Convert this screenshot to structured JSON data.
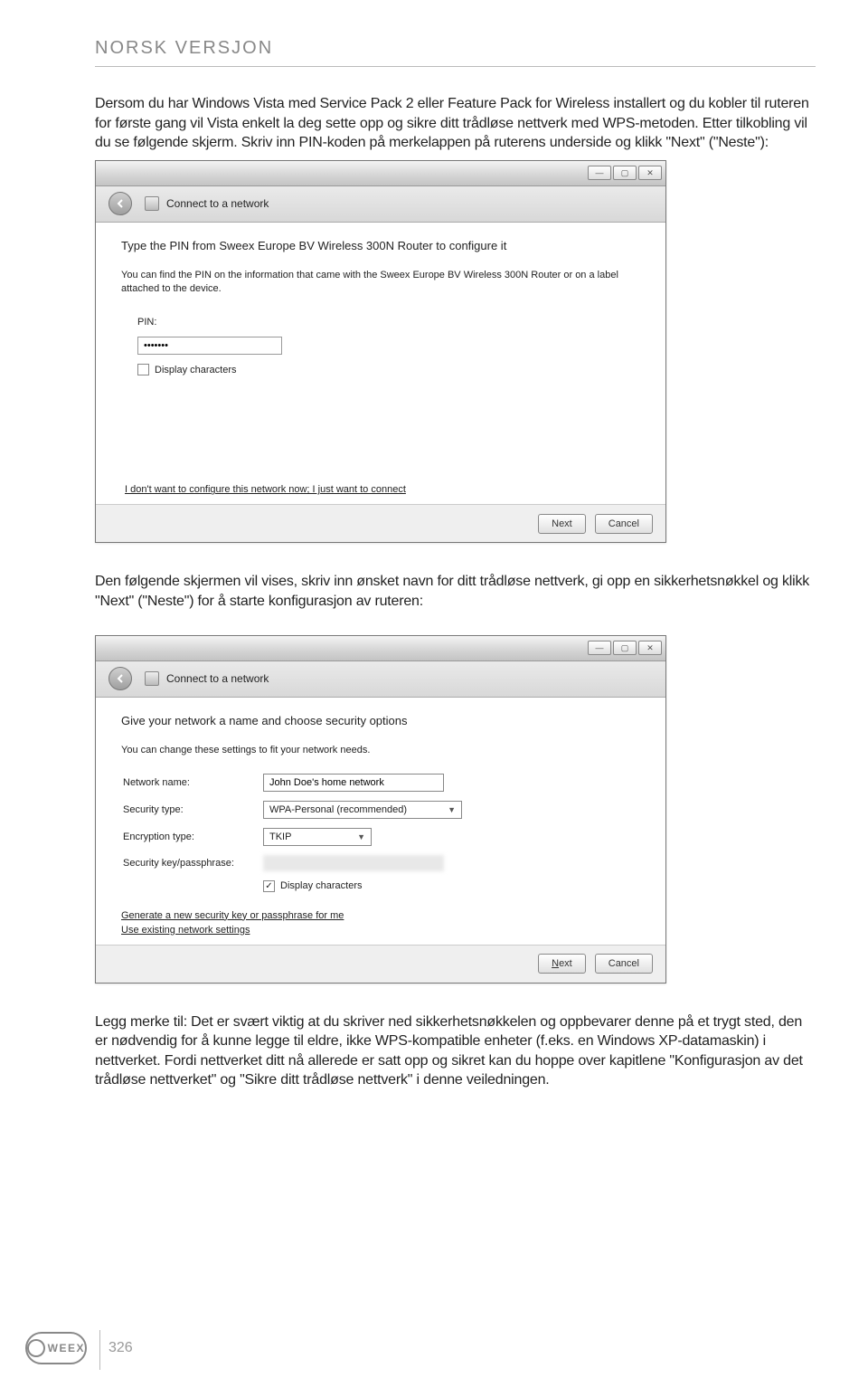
{
  "header": {
    "title": "NORSK VERSJON"
  },
  "paragraphs": {
    "p1": "Dersom du har Windows Vista med Service Pack 2 eller Feature Pack for Wireless installert og du kobler til ruteren for første gang vil Vista enkelt la deg sette opp og sikre ditt trådløse nettverk med WPS-metoden. Etter tilkobling vil du se følgende skjerm. Skriv inn PIN-koden på merkelappen på ruterens underside og klikk \"Next\" (\"Neste\"):",
    "p2": "Den følgende skjermen vil vises, skriv inn ønsket navn for ditt trådløse nettverk, gi opp en sikkerhetsnøkkel og klikk \"Next\" (\"Neste\") for å starte konfigurasjon av ruteren:",
    "p3": "Legg merke til: Det er svært viktig at du skriver ned sikkerhetsnøkkelen og oppbevarer denne på et trygt sted, den er nødvendig for å kunne legge til eldre, ikke WPS-kompatible enheter (f.eks. en Windows XP-datamaskin) i nettverket. Fordi nettverket ditt nå allerede er satt opp og sikret kan du hoppe over kapitlene \"Konfigurasjon av det trådløse nettverket\" og \"Sikre ditt trådløse nettverk\" i denne veiledningen."
  },
  "dialog1": {
    "nav_title": "Connect to a network",
    "heading": "Type the PIN from Sweex Europe BV Wireless 300N Router to configure it",
    "info": "You can find the PIN on the information that came with the Sweex Europe BV Wireless 300N Router or on a label attached to the device.",
    "pin_label": "PIN:",
    "pin_value": "•••••••",
    "display_chars": "Display characters",
    "skip_link": "I don't want to configure this network now; I just want to connect",
    "next": "Next",
    "cancel": "Cancel"
  },
  "dialog2": {
    "nav_title": "Connect to a network",
    "heading": "Give your network a name and choose security options",
    "info": "You can change these settings to fit your network needs.",
    "network_name_label": "Network name:",
    "network_name_value": "John Doe's home network",
    "security_type_label": "Security type:",
    "security_type_value": "WPA-Personal (recommended)",
    "encryption_type_label": "Encryption type:",
    "encryption_type_value": "TKIP",
    "key_label": "Security key/passphrase:",
    "display_chars": "Display characters",
    "gen_link": "Generate a new security key or passphrase for me",
    "use_link": "Use existing network settings",
    "next": "Next",
    "cancel": "Cancel"
  },
  "footer": {
    "brand": "WEEX",
    "page_number": "326"
  }
}
